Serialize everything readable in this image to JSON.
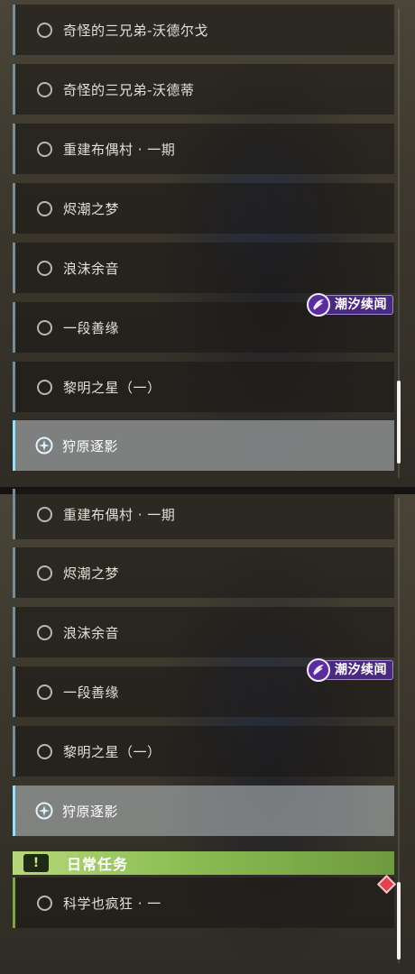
{
  "quest_badge": {
    "label": "潮汐续闻"
  },
  "top_list": {
    "items": [
      {
        "label": "奇怪的三兄弟-沃德尔戈",
        "state": "incomplete"
      },
      {
        "label": "奇怪的三兄弟-沃德蒂",
        "state": "incomplete"
      },
      {
        "label": "重建布偶村 · 一期",
        "state": "incomplete"
      },
      {
        "label": "烬潮之梦",
        "state": "incomplete"
      },
      {
        "label": "浪沫余音",
        "state": "incomplete"
      },
      {
        "label": "一段善缘",
        "state": "incomplete"
      },
      {
        "label": "黎明之星（一）",
        "state": "incomplete"
      },
      {
        "label": "狩原逐影",
        "state": "tracked"
      }
    ]
  },
  "bottom_list": {
    "items": [
      {
        "label": "重建布偶村 · 一期",
        "state": "incomplete"
      },
      {
        "label": "烬潮之梦",
        "state": "incomplete"
      },
      {
        "label": "浪沫余音",
        "state": "incomplete"
      },
      {
        "label": "一段善缘",
        "state": "incomplete"
      },
      {
        "label": "黎明之星（一）",
        "state": "incomplete"
      },
      {
        "label": "狩原逐影",
        "state": "tracked"
      }
    ],
    "daily_section": {
      "icon": "!",
      "title": "日常任务",
      "items": [
        {
          "label": "科学也疯狂 · 一",
          "state": "incomplete"
        }
      ]
    }
  },
  "colors": {
    "badge_purple": "#4a2a7e",
    "tracked_accent": "#9fdcf0",
    "daily_green": "#8bbd53",
    "notify_red": "#e0434f"
  }
}
